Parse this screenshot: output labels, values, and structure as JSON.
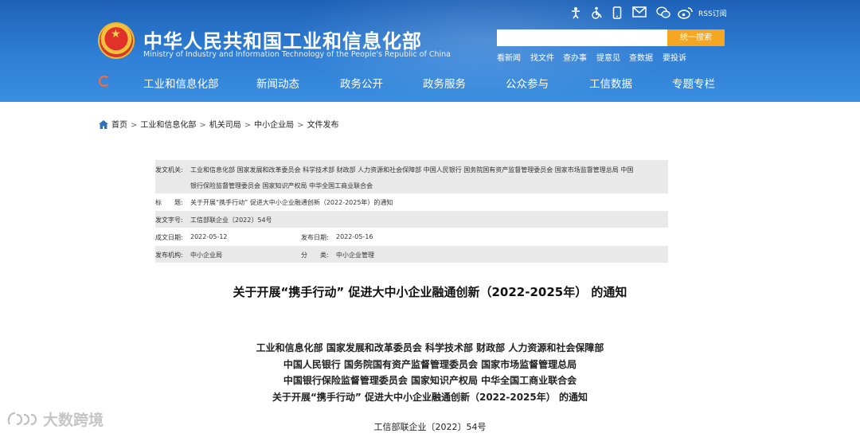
{
  "site": {
    "title": "中华人民共和国工业和信息化部",
    "subtitle": "Ministry of Industry and Information Technology of the People's Republic of China",
    "rss_label": "RSS订阅",
    "search_button": "统一搜索",
    "search_value": "",
    "quick_links": [
      "看新闻",
      "找文件",
      "查办事",
      "提意见",
      "查数据",
      "要投诉"
    ],
    "nav": [
      "工业和信息化部",
      "新闻动态",
      "政务公开",
      "政务服务",
      "公众参与",
      "工信数据",
      "专题专栏"
    ],
    "util_icons": [
      "accessibility-icon",
      "wheelchair-icon",
      "mobile-icon",
      "mail-icon",
      "wechat-icon",
      "weibo-icon"
    ]
  },
  "breadcrumb": [
    "首页",
    "工业和信息化部",
    "机关司局",
    "中小企业局",
    "文件发布"
  ],
  "meta": {
    "issuer_label": "发文机关:",
    "issuer_line1": "工业和信息化部 国家发展和改革委员会 科学技术部 财政部 人力资源和社会保障部 中国人民银行 国务院国有资产监督管理委员会 国家市场监督管理总局 中国",
    "issuer_line2": "银行保险监督管理委员会 国家知识产权局 中华全国工商业联合会",
    "title_label": "标　　题:",
    "title_value": "关于开展“携手行动” 促进大中小企业融通创新（2022-2025年）的通知",
    "docno_label": "发文字号:",
    "docno_value": "工信部联企业〔2022〕54号",
    "created_label": "成文日期:",
    "created_value": "2022-05-12",
    "published_label": "发布日期:",
    "published_value": "2022-05-16",
    "org_label": "发布机构:",
    "org_value": "中小企业局",
    "category_label": "分　　类:",
    "category_value": "中小企业管理"
  },
  "document": {
    "title": "关于开展“携手行动” 促进大中小企业融通创新（2022-2025年） 的通知",
    "issuers": [
      "工业和信息化部 国家发展和改革委员会 科学技术部 财政部 人力资源和社会保障部",
      "中国人民银行 国务院国有资产监督管理委员会 国家市场监督管理总局",
      "中国银行保险监督管理委员会 国家知识产权局 中华全国工商业联合会",
      "关于开展“携手行动” 促进大中小企业融通创新（2022-2025年） 的通知"
    ],
    "doc_number": "工信部联企业〔2022〕54号"
  },
  "watermark": "大数跨境",
  "colors": {
    "header_blue": "#2f7fd6",
    "search_orange": "#f5a623",
    "meta_gray": "#e9e9e9"
  }
}
